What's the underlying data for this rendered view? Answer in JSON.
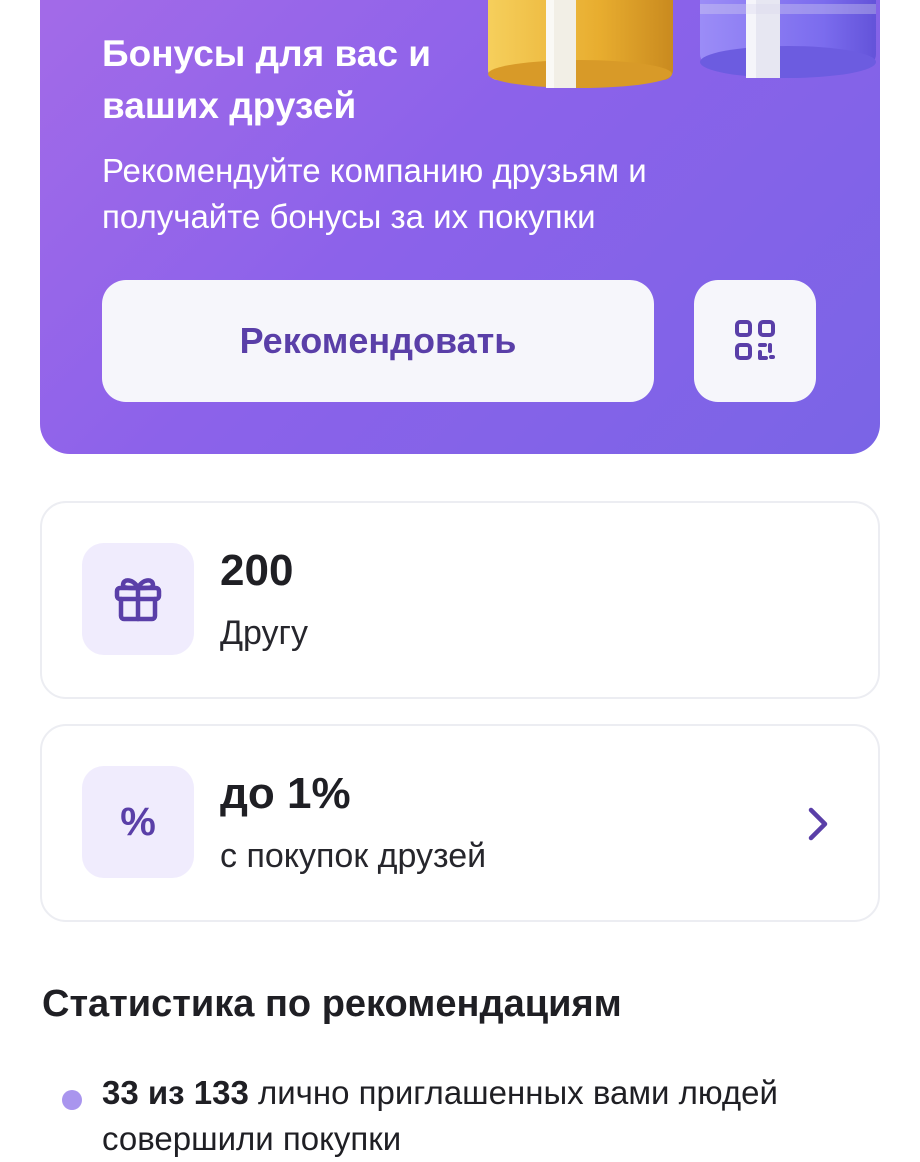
{
  "promo": {
    "title": "Бонусы для вас и ваших друзей",
    "subtitle": "Рекомендуйте компанию друзьям и получайте бонусы за их покупки",
    "recommend_label": "Рекомендовать",
    "qr_icon": "qr-code-icon",
    "illustration": "gift-boxes-illustration"
  },
  "cards": [
    {
      "icon": "gift-icon",
      "value": "200",
      "caption": "Другу"
    },
    {
      "icon": "percent-icon",
      "icon_glyph": "%",
      "value": "до 1%",
      "caption": "с покупок друзей",
      "chevron_icon": "chevron-right-icon"
    }
  ],
  "stats": {
    "title": "Статистика по рекомендациям",
    "items": [
      {
        "bold": "33 из 133",
        "text": " лично приглашенных вами людей совершили покупки"
      }
    ]
  },
  "colors": {
    "banner_gradient_start": "#a46be8",
    "banner_gradient_end": "#7a64e6",
    "accent": "#5a3fa8",
    "icon_tile": "#f0ecfd",
    "button_bg": "#f6f6fb",
    "bullet": "#a995ee"
  }
}
